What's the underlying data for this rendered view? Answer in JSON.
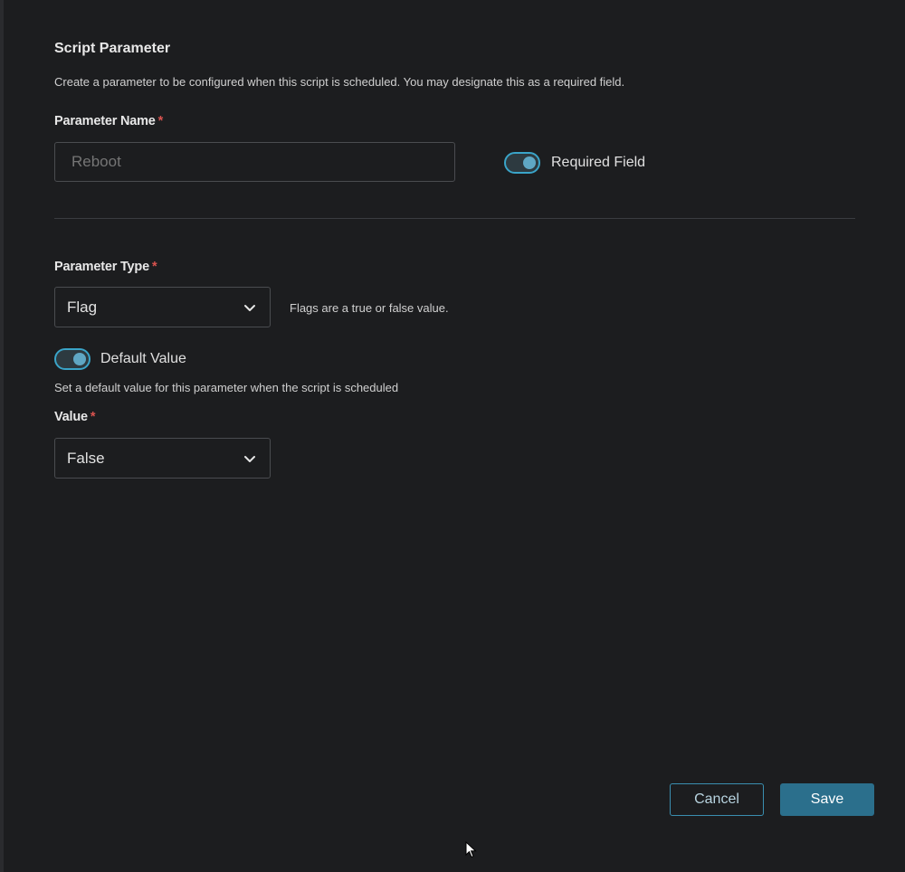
{
  "panel": {
    "title": "Script Parameter",
    "description": "Create a parameter to be configured when this script is scheduled. You may designate this as a required field."
  },
  "parameter_name": {
    "label": "Parameter Name",
    "required_marker": "*",
    "placeholder": "Reboot",
    "value": ""
  },
  "required_field": {
    "label": "Required Field",
    "enabled": true
  },
  "parameter_type": {
    "label": "Parameter Type",
    "required_marker": "*",
    "selected": "Flag",
    "hint": "Flags are a true or false value."
  },
  "default_value": {
    "label": "Default Value",
    "enabled": true,
    "description": "Set a default value for this parameter when the script is scheduled"
  },
  "value_field": {
    "label": "Value",
    "required_marker": "*",
    "selected": "False"
  },
  "actions": {
    "cancel_label": "Cancel",
    "save_label": "Save"
  },
  "icons": {
    "chevron": "chevron-down-icon",
    "cursor": "mouse-pointer-icon"
  },
  "colors": {
    "background": "#1c1d1f",
    "accent": "#2b6f8c",
    "toggle_border": "#3aa4c8",
    "required_star": "#d9534f"
  }
}
